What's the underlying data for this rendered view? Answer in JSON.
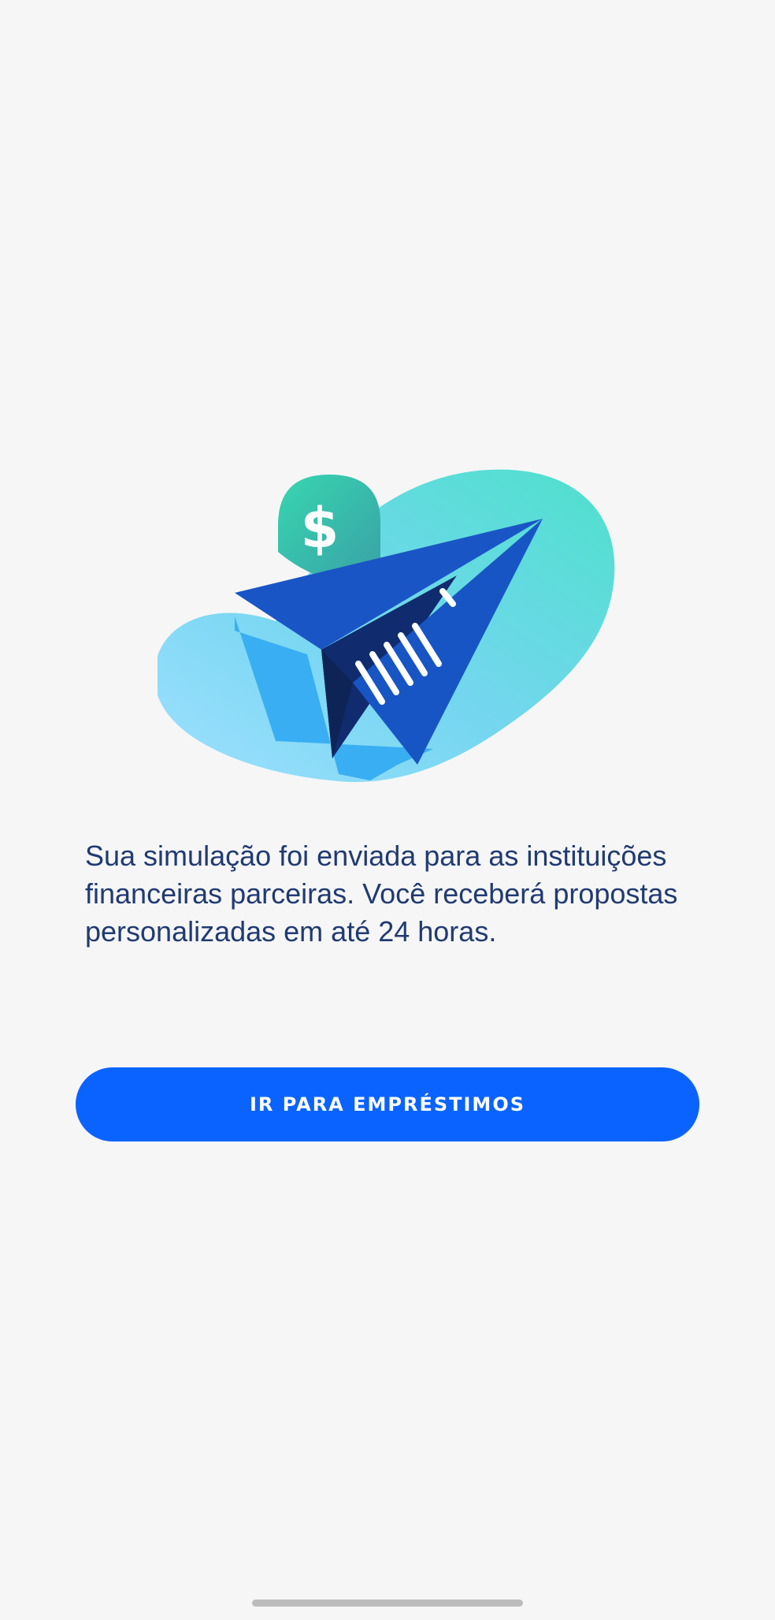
{
  "illustration": {
    "icon": "dollar-icon",
    "symbol": "$"
  },
  "message": "Sua simulação foi enviada para as instituições financeiras parceiras. Você receberá propostas personalizadas em até 24 horas.",
  "cta": {
    "label": "IR PARA EMPRÉSTIMOS"
  },
  "colors": {
    "background": "#f6f6f7",
    "text": "#213a72",
    "button": "#0a63ff",
    "button_text": "#ffffff",
    "home_indicator": "#bcbcbc"
  }
}
